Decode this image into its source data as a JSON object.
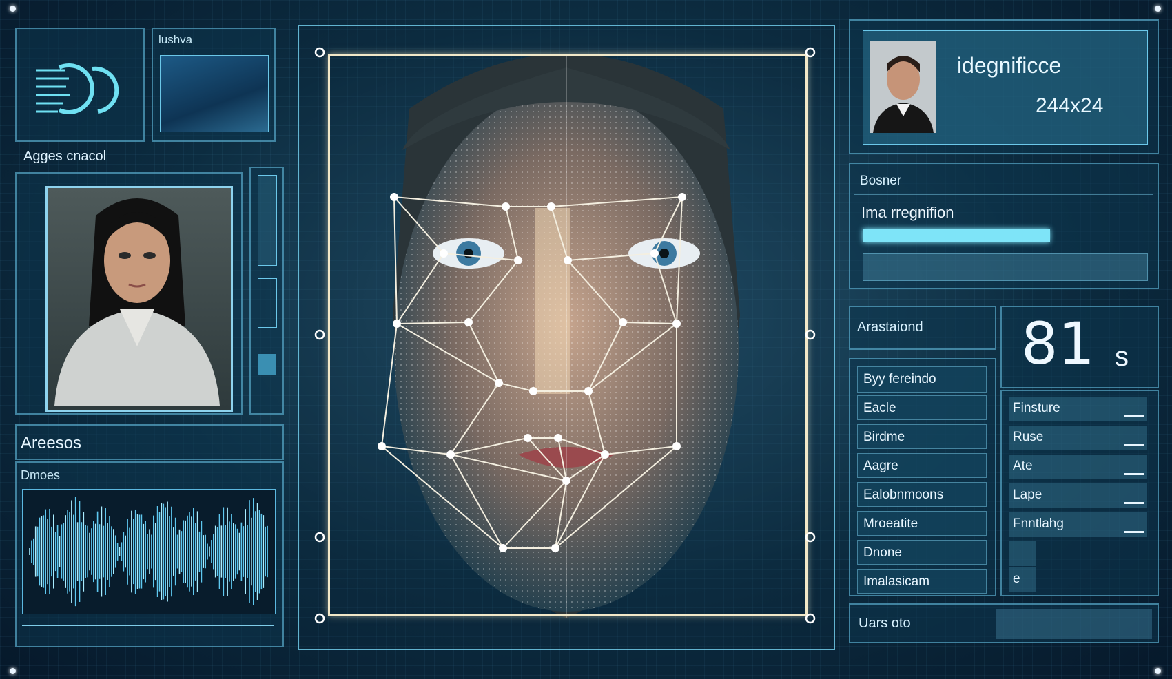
{
  "thumb": {
    "label": "lushva"
  },
  "left": {
    "portrait_title": "Agges cnacol",
    "section_title": "Areesos",
    "wave_label": "Dmoes"
  },
  "id_card": {
    "title": "idegnificce",
    "code": "244x24"
  },
  "region": {
    "header": "Bosner",
    "title": "Ima rregnifion",
    "progress": 0.66
  },
  "analysis": {
    "label": "Arastaiond",
    "timer_value": "81",
    "timer_unit": "s"
  },
  "list": {
    "header": "Byy fereindo",
    "items": [
      "Eacle",
      "Birdme",
      "Aagre",
      "Ealobnmoons",
      "Mroeatite",
      "Dnone",
      "Imalasicam"
    ]
  },
  "values": [
    "Finsture",
    "Ruse",
    "Ate",
    "Lape",
    "Fnntlahg",
    "",
    "e"
  ],
  "footer": {
    "label": "Uars oto"
  },
  "colors": {
    "accent": "#6fd8f6",
    "frame": "#f2e8c8",
    "panel_border": "#6ec8eb"
  }
}
